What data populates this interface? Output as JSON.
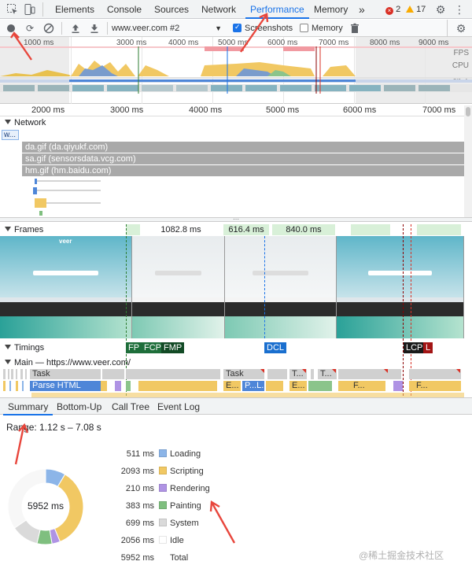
{
  "tabs": [
    {
      "label": "Elements"
    },
    {
      "label": "Console"
    },
    {
      "label": "Sources"
    },
    {
      "label": "Network"
    },
    {
      "label": "Performance"
    },
    {
      "label": "Memory"
    }
  ],
  "more_tabs": "»",
  "errors": "2",
  "warnings": "17",
  "toolbar": {
    "recording_select": "www.veer.com #2",
    "screenshots_label": "Screenshots",
    "memory_label": "Memory"
  },
  "overview": {
    "ticks": [
      "1000 ms",
      "3000 ms",
      "4000 ms",
      "5000 ms",
      "6000 ms",
      "7000 ms",
      "8000 ms",
      "9000 ms"
    ],
    "fps": "FPS",
    "cpu": "CPU",
    "net": "NET"
  },
  "ruler": [
    "2000 ms",
    "3000 ms",
    "4000 ms",
    "5000 ms",
    "6000 ms",
    "7000 ms"
  ],
  "network": {
    "title": "Network",
    "chip": "w...",
    "rows": [
      "da.gif (da.qiyukf.com)",
      "sa.gif (sensorsdata.vcg.com)",
      "hm.gif (hm.baidu.com)"
    ]
  },
  "frames": {
    "title": "Frames",
    "durations": [
      "1082.8 ms",
      "616.4 ms",
      "840.0 ms"
    ],
    "brand": "veer"
  },
  "timings": {
    "title": "Timings",
    "markers": [
      "FP",
      "FCP",
      "FMP",
      "DCL",
      "LCP",
      "L"
    ]
  },
  "main": {
    "title": "Main — https://www.veer.com/",
    "task": "Task",
    "parse": "Parse HTML",
    "task2": "Task",
    "t1": "T...",
    "t2": "T...",
    "e1": "E...",
    "p1": "P...L...",
    "e2": "E...",
    "f1": "F...",
    "f2": "F..."
  },
  "bottom_tabs": [
    "Summary",
    "Bottom-Up",
    "Call Tree",
    "Event Log"
  ],
  "summary": {
    "range": "Range: 1.12 s – 7.08 s",
    "total_center": "5952 ms",
    "rows": [
      {
        "value": "511 ms",
        "label": "Loading",
        "color": "#8cb5e8"
      },
      {
        "value": "2093 ms",
        "label": "Scripting",
        "color": "#f1c863"
      },
      {
        "value": "210 ms",
        "label": "Rendering",
        "color": "#af93e4"
      },
      {
        "value": "383 ms",
        "label": "Painting",
        "color": "#7fbf7f"
      },
      {
        "value": "699 ms",
        "label": "System",
        "color": "#dadada"
      },
      {
        "value": "2056 ms",
        "label": "Idle",
        "color": "#ffffff"
      },
      {
        "value": "5952 ms",
        "label": "Total",
        "color": ""
      }
    ],
    "donut": [
      511,
      2093,
      210,
      383,
      699,
      2056
    ]
  },
  "watermark": "@稀土掘金技术社区"
}
